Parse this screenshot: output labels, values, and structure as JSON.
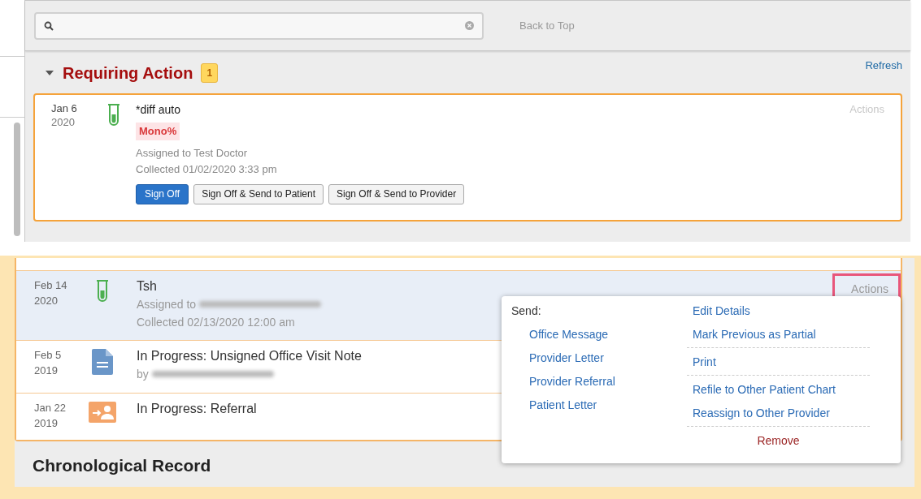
{
  "toolbar": {
    "back_to_top": "Back to Top"
  },
  "requiring_action": {
    "title": "Requiring Action",
    "expanded": true,
    "count": "1",
    "refresh": "Refresh",
    "item": {
      "date": "Jan 6",
      "year": "2020",
      "kind": "lab",
      "title": "*diff auto",
      "flag": "Mono%",
      "lines": [
        {
          "text": "Assigned to Test Doctor",
          "redacted": false
        },
        {
          "text": "Collected 01/02/2020 3:33 pm",
          "redacted": false
        }
      ],
      "actions": {
        "label": "Actions",
        "highlighted": false
      },
      "buttons": [
        {
          "label": "Sign Off",
          "primary": true
        },
        {
          "label": "Sign Off & Send to Patient",
          "primary": false
        },
        {
          "label": "Sign Off & Send to Provider",
          "primary": false
        }
      ]
    }
  },
  "record": {
    "items": [
      {
        "date": "Feb 14",
        "year": "2020",
        "kind": "lab",
        "title": "Tsh",
        "selected": true,
        "lines": [
          {
            "text": "Assigned to",
            "redacted": true
          },
          {
            "text": "Collected 02/13/2020 12:00 am",
            "redacted": false
          }
        ],
        "actions": {
          "label": "Actions",
          "highlighted": true
        }
      },
      {
        "date": "Feb 5",
        "year": "2019",
        "kind": "note",
        "title": "In Progress: Unsigned Office Visit Note",
        "selected": false,
        "lines": [
          {
            "text": "by",
            "redacted": true
          }
        ]
      },
      {
        "date": "Jan 22",
        "year": "2019",
        "kind": "referral",
        "title": "In Progress: Referral",
        "selected": false
      }
    ],
    "heading": "Chronological Record"
  },
  "menu": {
    "send_label": "Send:",
    "send_items": [
      "Office Message",
      "Provider Letter",
      "Provider Referral",
      "Patient Letter"
    ],
    "groups": [
      [
        "Edit Details",
        "Mark Previous as Partial"
      ],
      [
        "Print"
      ],
      [
        "Refile to Other Patient Chart",
        "Reassign to Other Provider"
      ]
    ],
    "remove": "Remove"
  }
}
